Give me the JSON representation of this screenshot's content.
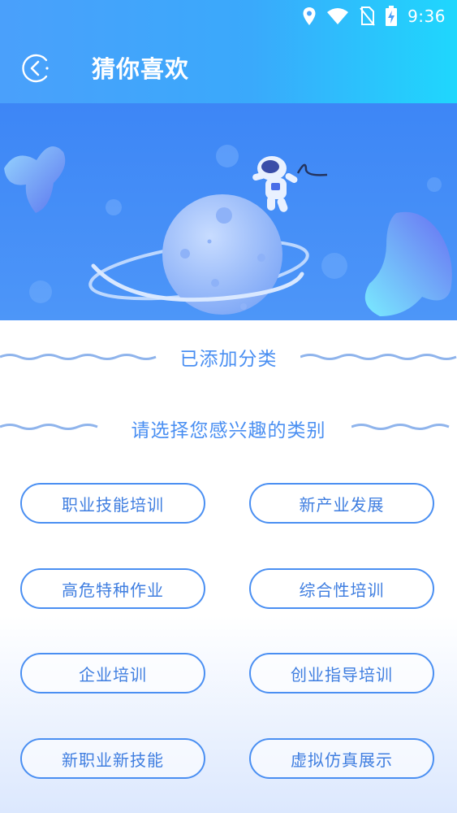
{
  "status_bar": {
    "time": "9:36",
    "icons": [
      "location-icon",
      "wifi-icon",
      "no-sim-icon",
      "battery-charging-icon"
    ]
  },
  "header": {
    "title": "猜你喜欢",
    "back_icon": "back-arrow-icon"
  },
  "sections": {
    "added_title": "已添加分类",
    "choose_title": "请选择您感兴趣的类别"
  },
  "categories": [
    "职业技能培训",
    "新产业发展",
    "高危特种作业",
    "综合性培训",
    "企业培训",
    "创业指导培训",
    "新职业新技能",
    "虚拟仿真展示"
  ],
  "colors": {
    "header_start": "#4aa0fb",
    "header_end": "#1fd7fd",
    "accent": "#4a8ff2",
    "chip_text": "#3f7ee0"
  }
}
